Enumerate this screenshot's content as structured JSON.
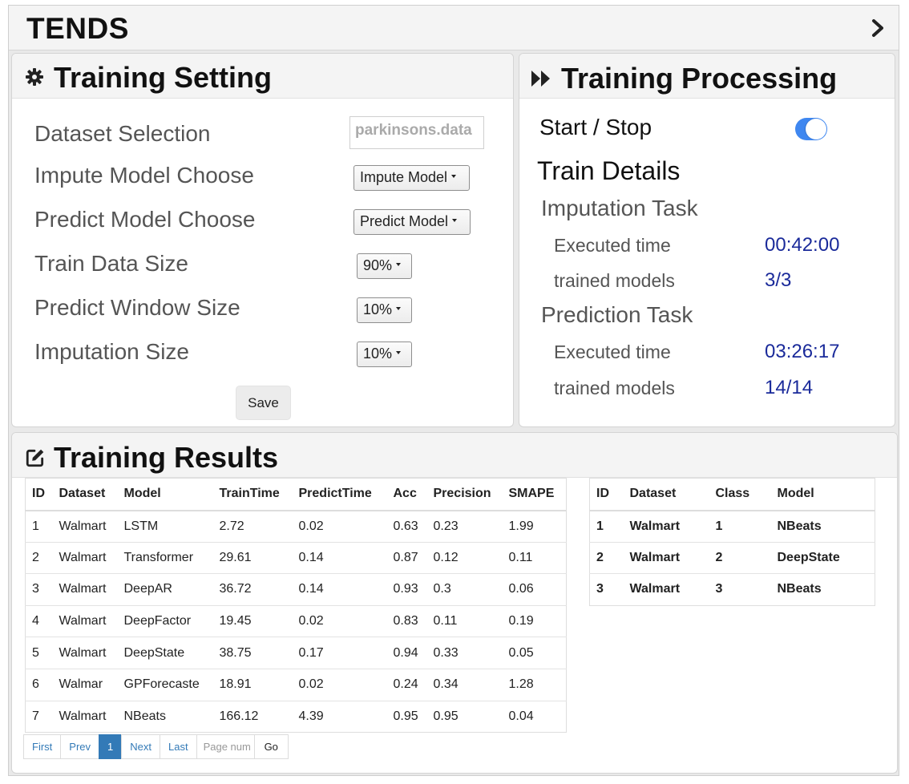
{
  "app": {
    "brand": "TENDS"
  },
  "setting": {
    "title": "Training Setting",
    "rows": [
      {
        "label": "Dataset Selection",
        "value": "parkinsons.data"
      },
      {
        "label": "Impute Model Choose",
        "value": "Impute Model"
      },
      {
        "label": "Predict Model Choose",
        "value": "Predict Model"
      },
      {
        "label": "Train Data Size",
        "value": "90%"
      },
      {
        "label": "Predict Window Size",
        "value": "10%"
      },
      {
        "label": "Imputation Size",
        "value": "10%"
      }
    ],
    "save_label": "Save"
  },
  "processing": {
    "title": "Training Processing",
    "start_stop_label": "Start / Stop",
    "toggle_on": true,
    "details_title": "Train Details",
    "imputation": {
      "title": "Imputation Task",
      "executed_label": "Executed time",
      "executed_value": "00:42:00",
      "models_label": "trained models",
      "models_value": "3/3"
    },
    "prediction": {
      "title": "Prediction Task",
      "executed_label": "Executed time",
      "executed_value": "03:26:17",
      "models_label": "trained models",
      "models_value": "14/14"
    }
  },
  "results": {
    "title": "Training Results",
    "main_table": {
      "headers": [
        "ID",
        "Dataset",
        "Model",
        "TrainTime",
        "PredictTime",
        "Acc",
        "Precision",
        "SMAPE"
      ],
      "rows": [
        [
          "1",
          "Walmart",
          "LSTM",
          "2.72",
          "0.02",
          "0.63",
          "0.23",
          "1.99"
        ],
        [
          "2",
          "Walmart",
          "Transformer",
          "29.61",
          "0.14",
          "0.87",
          "0.12",
          "0.11"
        ],
        [
          "3",
          "Walmart",
          "DeepAR",
          "36.72",
          "0.14",
          "0.93",
          "0.3",
          "0.06"
        ],
        [
          "4",
          "Walmart",
          "DeepFactor",
          "19.45",
          "0.02",
          "0.83",
          "0.11",
          "0.19"
        ],
        [
          "5",
          "Walmart",
          "DeepState",
          "38.75",
          "0.17",
          "0.94",
          "0.33",
          "0.05"
        ],
        [
          "6",
          "Walmar",
          "GPForecaste",
          "18.91",
          "0.02",
          "0.24",
          "0.34",
          "1.28"
        ],
        [
          "7",
          "Walmart",
          "NBeats",
          "166.12",
          "4.39",
          "0.95",
          "0.95",
          "0.04"
        ]
      ]
    },
    "class_table": {
      "headers": [
        "ID",
        "Dataset",
        "Class",
        "Model"
      ],
      "rows": [
        [
          "1",
          "Walmart",
          "1",
          "NBeats"
        ],
        [
          "2",
          "Walmart",
          "2",
          "DeepState"
        ],
        [
          "3",
          "Walmart",
          "3",
          "NBeats"
        ]
      ]
    },
    "pager": {
      "first": "First",
      "prev": "Prev",
      "current": "1",
      "next": "Next",
      "last": "Last",
      "page_placeholder": "Page num",
      "go": "Go"
    }
  }
}
